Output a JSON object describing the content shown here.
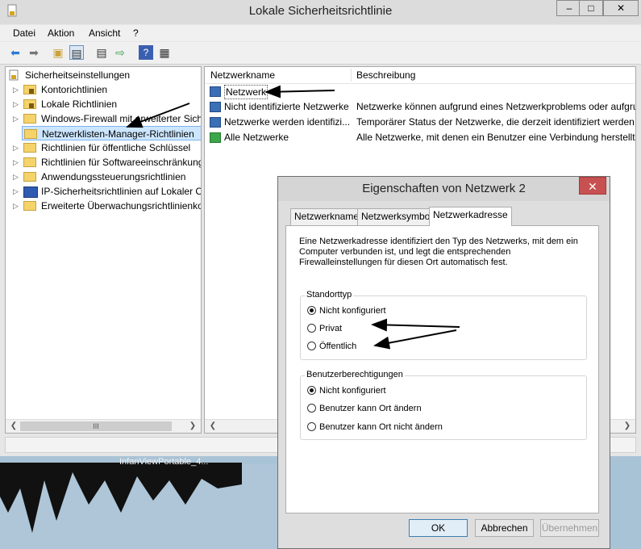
{
  "main_window": {
    "title": "Lokale Sicherheitsrichtlinie",
    "min": "–",
    "max": "□",
    "close": "✕"
  },
  "menu": [
    "Datei",
    "Aktion",
    "Ansicht",
    "?"
  ],
  "toolbar_icons": [
    "back-icon",
    "forward-icon",
    "up-folder-icon",
    "show-hide-tree-icon",
    "properties-icon",
    "export-icon",
    "help-icon",
    "view-icon"
  ],
  "tree": {
    "root": "Sicherheitseinstellungen",
    "items": [
      {
        "label": "Kontorichtlinien",
        "icon": "lock-folder-icon"
      },
      {
        "label": "Lokale Richtlinien",
        "icon": "lock-folder-icon"
      },
      {
        "label": "Windows-Firewall mit erweiterter Sich",
        "icon": "folder-icon"
      },
      {
        "label": "Netzwerklisten-Manager-Richtlinien",
        "icon": "folder-icon",
        "selected": true
      },
      {
        "label": "Richtlinien für öffentliche Schlüssel",
        "icon": "folder-icon"
      },
      {
        "label": "Richtlinien für Softwareeinschränkung",
        "icon": "folder-icon"
      },
      {
        "label": "Anwendungssteuerungsrichtlinien",
        "icon": "folder-icon"
      },
      {
        "label": "IP-Sicherheitsrichtlinien auf Lokaler C",
        "icon": "shield-computer-icon"
      },
      {
        "label": "Erweiterte Überwachungsrichtlinienko",
        "icon": "folder-icon"
      }
    ],
    "scroll_thumb": "III"
  },
  "list": {
    "columns": [
      "Netzwerkname",
      "Beschreibung"
    ],
    "rows": [
      {
        "name": "Netzwerk",
        "desc": ""
      },
      {
        "name": "Nicht identifizierte Netzwerke",
        "desc": "Netzwerke können aufgrund eines Netzwerkproblems oder aufgru"
      },
      {
        "name": "Netzwerke werden identifizi...",
        "desc": "Temporärer Status der Netzwerke, die derzeit identifiziert werden."
      },
      {
        "name": "Alle Netzwerke",
        "desc": "Alle Netzwerke, mit denen ein Benutzer eine Verbindung herstellt."
      }
    ]
  },
  "desktop": {
    "label": "InfanViewPortable_4..."
  },
  "dialog": {
    "title": "Eigenschaften von Netzwerk  2",
    "close": "✕",
    "tabs": [
      "Netzwerkname",
      "Netzwerksymbol",
      "Netzwerkadresse"
    ],
    "active_tab": 2,
    "description": "Eine Netzwerkadresse identifiziert den Typ des Netzwerks, mit dem ein Computer verbunden ist, und legt die entsprechenden Firewalleinstellungen für diesen Ort automatisch fest.",
    "standort": {
      "label": "Standorttyp",
      "options": [
        "Nicht konfiguriert",
        "Privat",
        "Öffentlich"
      ],
      "selected": 0
    },
    "benutzer": {
      "label": "Benutzerberechtigungen",
      "options": [
        "Nicht konfiguriert",
        "Benutzer kann Ort ändern",
        "Benutzer kann Ort nicht ändern"
      ],
      "selected": 0
    },
    "buttons": {
      "ok": "OK",
      "cancel": "Abbrechen",
      "apply": "Übernehmen"
    }
  },
  "colors": {
    "selection": "#cce6ff",
    "close_red": "#c75050",
    "arrow": "#000000"
  }
}
